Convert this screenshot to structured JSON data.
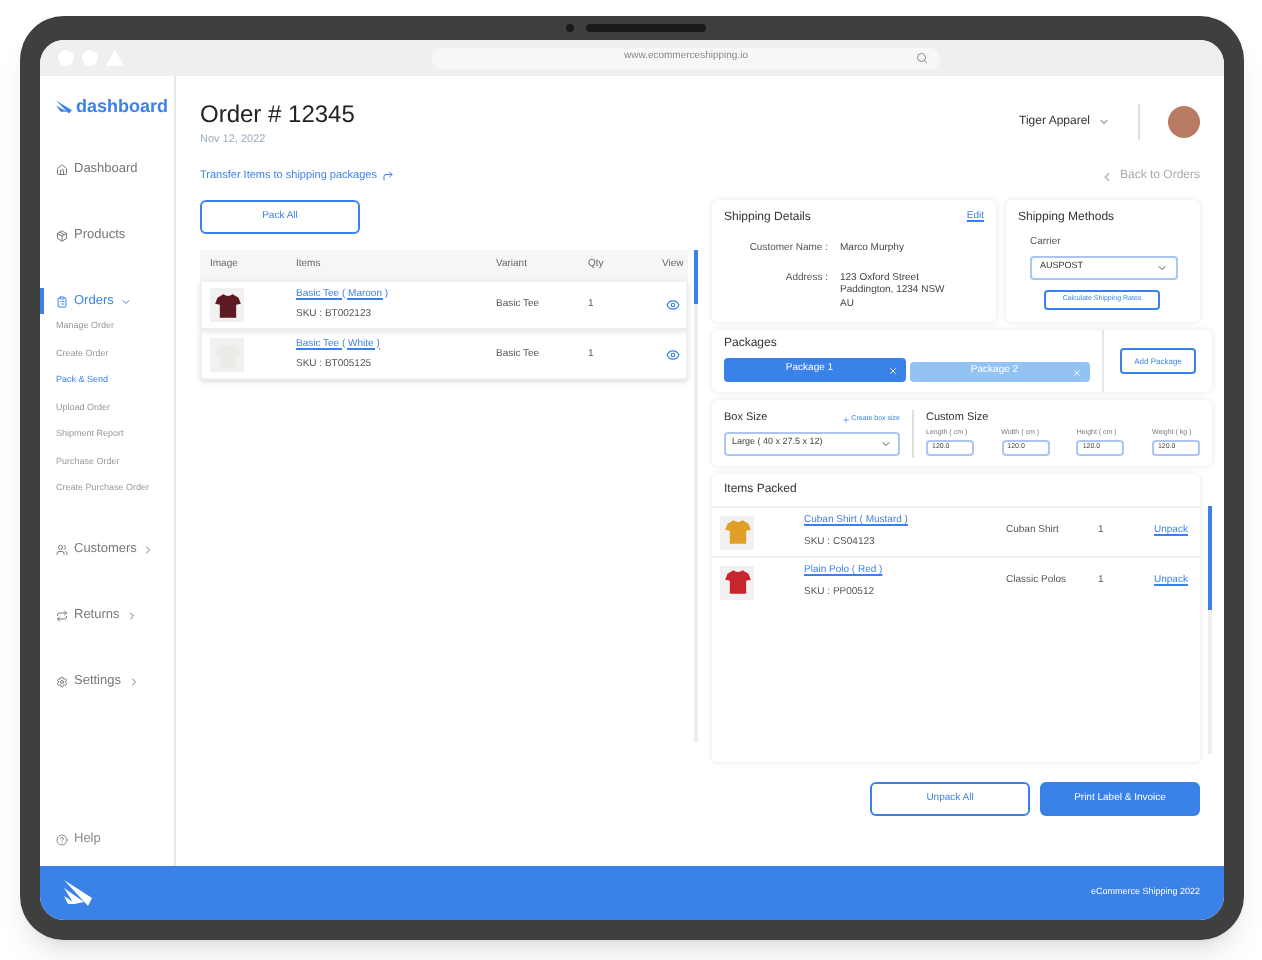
{
  "browser": {
    "url": "www.ecommerceshipping.io"
  },
  "sidebar": {
    "logo": "dashboard",
    "items": [
      {
        "kind": "link",
        "label": "Dashboard",
        "selected": false
      },
      {
        "kind": "link",
        "label": "Products",
        "selected": false
      },
      {
        "kind": "group",
        "label": "Orders",
        "selected": true,
        "expanded": true,
        "children": [
          {
            "label": "Manage Order",
            "selected": false
          },
          {
            "label": "Create Order",
            "selected": false
          },
          {
            "label": "Pack & Send",
            "selected": true
          },
          {
            "label": "Upload Order",
            "selected": false
          },
          {
            "label": "Shipment Report",
            "selected": false
          },
          {
            "label": "Purchase Order",
            "selected": false
          },
          {
            "label": "Create Purchase Order",
            "selected": false
          }
        ]
      },
      {
        "kind": "group",
        "label": "Customers",
        "selected": false,
        "expanded": false
      },
      {
        "kind": "group",
        "label": "Returns",
        "selected": false,
        "expanded": false
      },
      {
        "kind": "group",
        "label": "Settings",
        "selected": false,
        "expanded": false
      }
    ],
    "help": "Help"
  },
  "header": {
    "title": "Order # 12345",
    "date": "Nov 12, 2022",
    "store": "Tiger Apparel"
  },
  "transfer_link": "Transfer Items to shipping packages",
  "back_link": "Back to Orders",
  "pack_all_button": "Pack All",
  "order_items": {
    "columns": [
      "Image",
      "Items",
      "Variant",
      "Qty",
      "View"
    ],
    "rows": [
      {
        "name": "Basic Tee ( Maroon )",
        "sku": "SKU : BT002123",
        "variant": "Basic Tee",
        "qty": "1",
        "color": "#5e1a24"
      },
      {
        "name": "Basic Tee ( White )",
        "sku": "SKU : BT005125",
        "variant": "Basic Tee",
        "qty": "1",
        "color": "#ecebe8"
      }
    ]
  },
  "shipping_details": {
    "title": "Shipping Details",
    "edit": "Edit",
    "fields": [
      {
        "label": "Customer Name :",
        "lines": [
          "Marco Murphy"
        ]
      },
      {
        "label": "Address :",
        "lines": [
          "123 Oxford Street",
          "Paddington, 1234 NSW",
          "AU"
        ]
      }
    ]
  },
  "shipping_methods": {
    "title": "Shipping Methods",
    "carrier_label": "Carrier",
    "carrier": "AUSPOST",
    "calculate_button": "Calculate Shipping Rates"
  },
  "packages": {
    "title": "Packages",
    "tabs": [
      {
        "label": "Package 1",
        "selected": true
      },
      {
        "label": "Package 2",
        "selected": false
      }
    ],
    "add_button": "Add Package"
  },
  "box_size": {
    "label": "Box Size",
    "create_link": "Create box size",
    "value": "Large ( 40 x 27.5 x 12)"
  },
  "custom_size": {
    "title": "Custom Size",
    "fields": [
      {
        "label": "Length ( cm )",
        "value": "120.0"
      },
      {
        "label": "Width ( cm )",
        "value": "120.0"
      },
      {
        "label": "Height ( cm )",
        "value": "120.0"
      },
      {
        "label": "Weight ( kg )",
        "value": "120.0"
      }
    ]
  },
  "items_packed": {
    "title": "Items Packed",
    "rows": [
      {
        "name": "Cuban Shirt ( Mustard )",
        "sku": "SKU : CS04123",
        "variant": "Cuban Shirt",
        "qty": "1",
        "action": "Unpack",
        "color": "#e0a028"
      },
      {
        "name": "Plain Polo ( Red )",
        "sku": "SKU : PP00512",
        "variant": "Classic Polos",
        "qty": "1",
        "action": "Unpack",
        "color": "#c8262e"
      }
    ]
  },
  "unpack_all_button": "Unpack All",
  "print_button": "Print Label & Invoice",
  "footer": "eCommerce Shipping 2022"
}
